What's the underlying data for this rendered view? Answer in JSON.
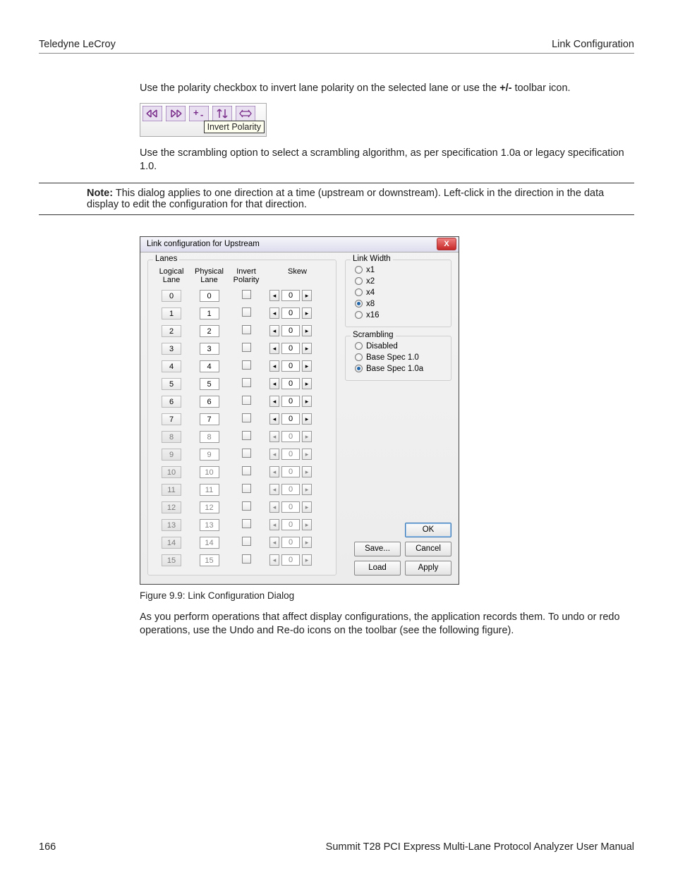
{
  "header": {
    "left": "Teledyne LeCroy",
    "right": "Link Configuration"
  },
  "paras": {
    "p1a": "Use the polarity checkbox to invert lane polarity on the selected lane or use the ",
    "p1b": "+/-",
    "p1c": " toolbar icon.",
    "p2": "Use the scrambling option to select a scrambling algorithm, as per specification 1.0a or legacy specification 1.0.",
    "note_label": "Note:",
    "note_body1": "This dialog applies to one direction at a time (upstream or downstream). Left-click in the direction in the data display to edit the configuration for that direction.",
    "p3": "As you perform operations that affect display configurations, the application records them. To undo or redo operations, use the Undo and Re-do icons on the toolbar (see the following figure)."
  },
  "toolbar_tooltip": "Invert Polarity",
  "dialog": {
    "title": "Link configuration for Upstream",
    "close": "X",
    "lanes": {
      "legend": "Lanes",
      "h1": "Logical Lane",
      "h2": "Physical Lane",
      "h3": "Invert Polarity",
      "h4": "Skew",
      "rows": [
        {
          "log": "0",
          "phy": "0",
          "skew": "0",
          "enabled": true
        },
        {
          "log": "1",
          "phy": "1",
          "skew": "0",
          "enabled": true
        },
        {
          "log": "2",
          "phy": "2",
          "skew": "0",
          "enabled": true
        },
        {
          "log": "3",
          "phy": "3",
          "skew": "0",
          "enabled": true
        },
        {
          "log": "4",
          "phy": "4",
          "skew": "0",
          "enabled": true
        },
        {
          "log": "5",
          "phy": "5",
          "skew": "0",
          "enabled": true
        },
        {
          "log": "6",
          "phy": "6",
          "skew": "0",
          "enabled": true
        },
        {
          "log": "7",
          "phy": "7",
          "skew": "0",
          "enabled": true
        },
        {
          "log": "8",
          "phy": "8",
          "skew": "0",
          "enabled": false
        },
        {
          "log": "9",
          "phy": "9",
          "skew": "0",
          "enabled": false
        },
        {
          "log": "10",
          "phy": "10",
          "skew": "0",
          "enabled": false
        },
        {
          "log": "11",
          "phy": "11",
          "skew": "0",
          "enabled": false
        },
        {
          "log": "12",
          "phy": "12",
          "skew": "0",
          "enabled": false
        },
        {
          "log": "13",
          "phy": "13",
          "skew": "0",
          "enabled": false
        },
        {
          "log": "14",
          "phy": "14",
          "skew": "0",
          "enabled": false
        },
        {
          "log": "15",
          "phy": "15",
          "skew": "0",
          "enabled": false
        }
      ]
    },
    "link_width": {
      "legend": "Link Width",
      "options": [
        {
          "label": "x1",
          "checked": false
        },
        {
          "label": "x2",
          "checked": false
        },
        {
          "label": "x4",
          "checked": false
        },
        {
          "label": "x8",
          "checked": true
        },
        {
          "label": "x16",
          "checked": false
        }
      ]
    },
    "scrambling": {
      "legend": "Scrambling",
      "options": [
        {
          "label": "Disabled",
          "checked": false
        },
        {
          "label": "Base Spec 1.0",
          "checked": false
        },
        {
          "label": "Base Spec 1.0a",
          "checked": true
        }
      ]
    },
    "buttons": {
      "ok": "OK",
      "save": "Save...",
      "cancel": "Cancel",
      "load": "Load",
      "apply": "Apply"
    }
  },
  "figure_caption": "Figure 9.9:  Link Configuration Dialog",
  "footer": {
    "page": "166",
    "title": "Summit T28 PCI Express Multi-Lane Protocol Analyzer User Manual"
  }
}
